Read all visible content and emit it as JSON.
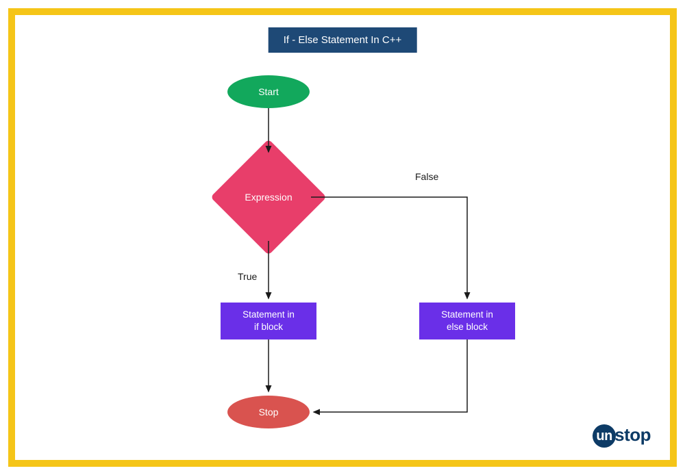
{
  "title": "If - Else Statement In C++",
  "nodes": {
    "start": "Start",
    "expression": "Expression",
    "if_block": "Statement in\nif block",
    "else_block": "Statement in\nelse block",
    "stop": "Stop"
  },
  "edges": {
    "true_label": "True",
    "false_label": "False"
  },
  "logo": {
    "prefix": "un",
    "suffix": "stop"
  }
}
